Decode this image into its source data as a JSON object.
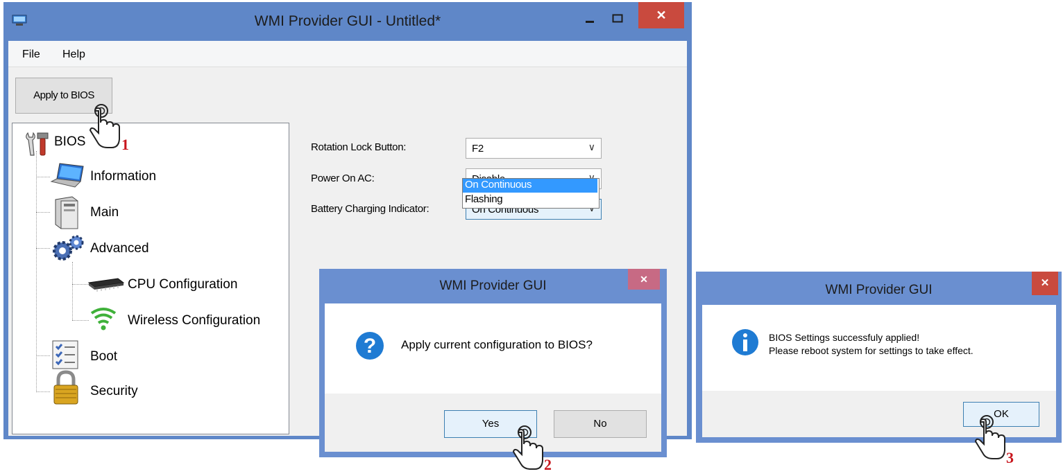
{
  "main_window": {
    "title": "WMI Provider GUI - Untitled*",
    "close_symbol": "✕",
    "menu": [
      "File",
      "Help"
    ],
    "apply_button": "Apply to BIOS",
    "tree": {
      "root": "BIOS",
      "items": [
        "Information",
        "Main",
        "Advanced",
        "CPU Configuration",
        "Wireless Configuration",
        "Boot",
        "Security"
      ]
    },
    "settings": [
      {
        "label": "Rotation Lock Button:",
        "value": "F2"
      },
      {
        "label": "Power On AC:",
        "value": "Disable"
      },
      {
        "label": "Battery Charging Indicator:",
        "value": "On Continuous"
      }
    ],
    "dropdown_options": [
      "On Continuous",
      "Flashing"
    ]
  },
  "confirm_dialog": {
    "title": "WMI Provider GUI",
    "message": "Apply current configuration to BIOS?",
    "yes": "Yes",
    "no": "No",
    "close_symbol": "✕"
  },
  "info_dialog": {
    "title": "WMI Provider GUI",
    "message_line1": "BIOS Settings successfuly applied!",
    "message_line2": "Please reboot system for settings to take effect.",
    "ok": "OK",
    "close_symbol": "✕"
  },
  "steps": [
    "1",
    "2",
    "3"
  ],
  "colors": {
    "titlebar": "#5f87c8",
    "dialog_titlebar": "#6a8fd0",
    "close_red": "#c94a3e",
    "selection_blue": "#3399ff",
    "step_red": "#c8161d"
  }
}
